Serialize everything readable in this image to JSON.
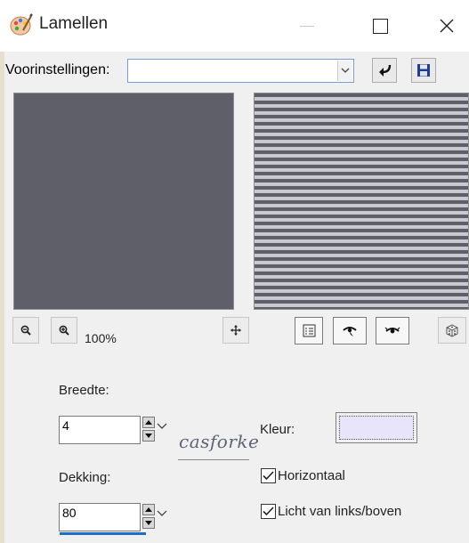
{
  "window": {
    "title": "Lamellen",
    "icon": "palette-icon"
  },
  "presets": {
    "label": "Voorinstellingen:",
    "selected_value": "",
    "reset_icon": "reset-arrow-icon",
    "save_icon": "floppy-disk-icon"
  },
  "zoom": {
    "level": "100%"
  },
  "settings": {
    "breedte_label": "Breedte:",
    "breedte_value": "4",
    "dekking_label": "Dekking:",
    "dekking_value": "80",
    "kleur_label": "Kleur:",
    "kleur_color": "#e8e4fb",
    "horizontaal_label": "Horizontaal",
    "horizontaal_checked": true,
    "licht_label": "Licht van links/boven",
    "licht_checked": true
  },
  "watermark": {
    "text": "casforke"
  },
  "colors": {
    "preview_dark": "#5f5f69",
    "preview_light": "#c9c9cf",
    "accent_blue": "#1e6ec8"
  }
}
